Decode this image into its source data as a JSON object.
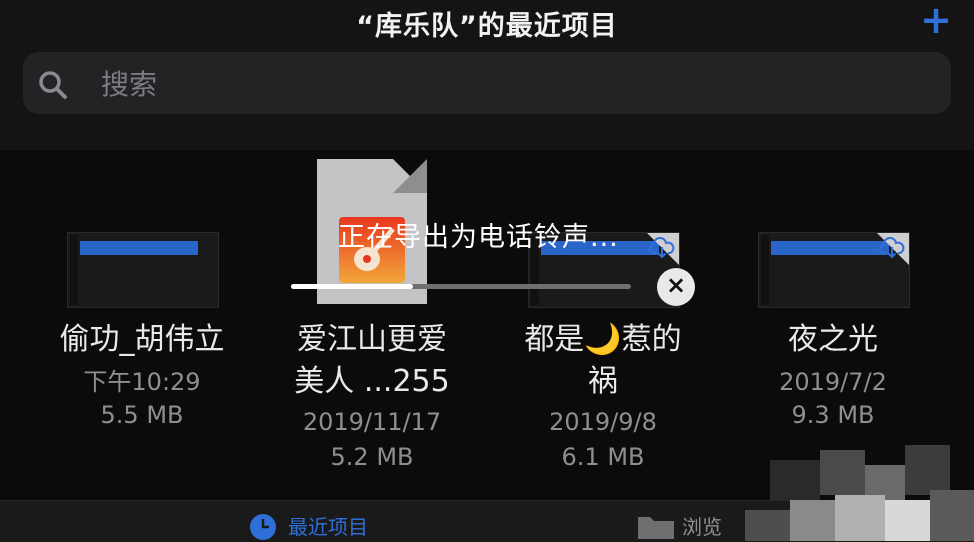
{
  "header": {
    "title": "“库乐队”的最近项目",
    "add_label": "+"
  },
  "search": {
    "placeholder": "搜索"
  },
  "files": [
    {
      "name": "偷功_胡伟立",
      "line2": "",
      "date": "下午10:29",
      "size": "5.5 MB"
    },
    {
      "name": "爱江山更爱",
      "line2": "美人 ...255",
      "date": "2019/11/17",
      "size": "5.2 MB"
    },
    {
      "name": "都是🌙惹的",
      "line2": "祸",
      "date": "2019/9/8",
      "size": "6.1 MB"
    },
    {
      "name": "夜之光",
      "line2": "",
      "date": "2019/7/2",
      "size": "9.3 MB"
    }
  ],
  "export_dialog": {
    "message": "正在导出为电话铃声...",
    "progress": 0.36,
    "close_label": "×"
  },
  "tabs": [
    {
      "label": "最近项目",
      "active": true
    },
    {
      "label": "浏览",
      "active": false
    }
  ],
  "colors": {
    "accent": "#2f6fd8",
    "background": "#0b0b0c"
  }
}
